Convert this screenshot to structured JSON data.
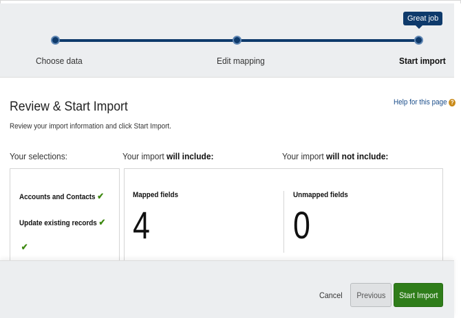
{
  "progress": {
    "tooltip": "Great job",
    "steps": [
      {
        "label": "Choose data"
      },
      {
        "label": "Edit mapping"
      },
      {
        "label": "Start import"
      }
    ]
  },
  "page": {
    "title": "Review & Start Import",
    "subtitle": "Review your import information and click Start Import.",
    "help_link": "Help for this page",
    "help_icon": "?"
  },
  "columns": {
    "selections_heading": "Your selections:",
    "include_prefix": "Your import ",
    "include_bold": "will include:",
    "exclude_prefix": "Your import ",
    "exclude_bold": "will not include:"
  },
  "selections": [
    {
      "label": "Accounts and Contacts",
      "check": "✔"
    },
    {
      "label": "Update existing records",
      "check": "✔"
    },
    {
      "label": "",
      "check": "✔"
    }
  ],
  "include": {
    "label": "Mapped fields",
    "count": "4"
  },
  "exclude": {
    "label": "Unmapped fields",
    "count": "0"
  },
  "footer": {
    "cancel": "Cancel",
    "previous": "Previous",
    "start": "Start Import"
  },
  "colors": {
    "accent": "#0e3a6b",
    "primary_button": "#2f7d1a",
    "check": "#3f8a12",
    "link": "#1a4d8a"
  }
}
